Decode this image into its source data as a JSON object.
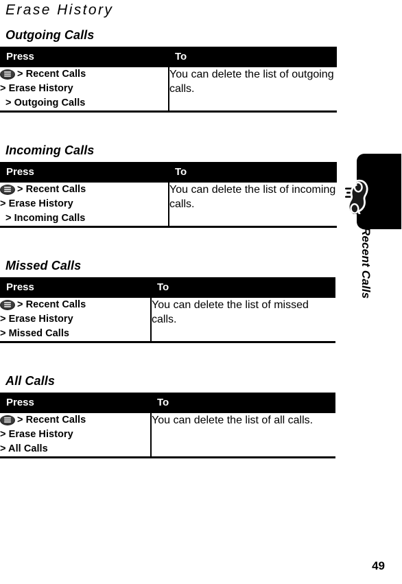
{
  "page": {
    "title": "Erase History",
    "folio": "49"
  },
  "sidebar": {
    "tab_label": "Recent Calls",
    "phone_icon": "phone-handset-icon",
    "tab_color": "#000000"
  },
  "table_headers": {
    "press": "Press",
    "to": "To"
  },
  "icons": {
    "menu_key": "menu-key-icon"
  },
  "sections": [
    {
      "heading": "Outgoing Calls",
      "press_lines": [
        "> Recent Calls",
        "> Erase History",
        "> Outgoing Calls"
      ],
      "to": "You can delete the list of outgoing calls."
    },
    {
      "heading": "Incoming Calls",
      "press_lines": [
        "> Recent Calls",
        "> Erase History",
        "> Incoming Calls"
      ],
      "to": "You can delete the list of incoming calls."
    },
    {
      "heading": "Missed Calls",
      "press_lines": [
        "> Recent Calls",
        "> Erase History",
        "> Missed Calls"
      ],
      "to": "You can delete the list of missed calls."
    },
    {
      "heading": "All Calls",
      "press_lines": [
        "> Recent Calls",
        "> Erase History",
        "> All Calls"
      ],
      "to": "You can delete the list of all calls."
    }
  ]
}
